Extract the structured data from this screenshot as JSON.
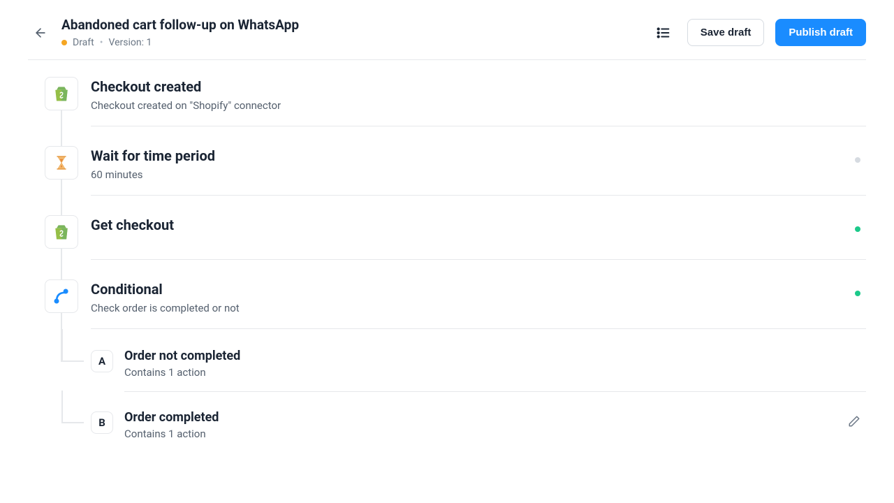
{
  "header": {
    "title": "Abandoned cart follow-up on WhatsApp",
    "status_label": "Draft",
    "version_label": "Version: 1",
    "save_label": "Save draft",
    "publish_label": "Publish draft"
  },
  "steps": [
    {
      "icon": "shopify",
      "title": "Checkout created",
      "subtitle": "Checkout created on \"Shopify\" connector",
      "status": null
    },
    {
      "icon": "hourglass",
      "title": "Wait for time period",
      "subtitle": "60 minutes",
      "status": "grey"
    },
    {
      "icon": "shopify",
      "title": "Get checkout",
      "subtitle": "",
      "status": "green"
    },
    {
      "icon": "conditional",
      "title": "Conditional",
      "subtitle": "Check order is completed or not",
      "status": "green"
    }
  ],
  "branches": [
    {
      "badge": "A",
      "title": "Order not completed",
      "subtitle": "Contains 1 action",
      "editable": false
    },
    {
      "badge": "B",
      "title": "Order completed",
      "subtitle": "Contains 1 action",
      "editable": true
    }
  ]
}
